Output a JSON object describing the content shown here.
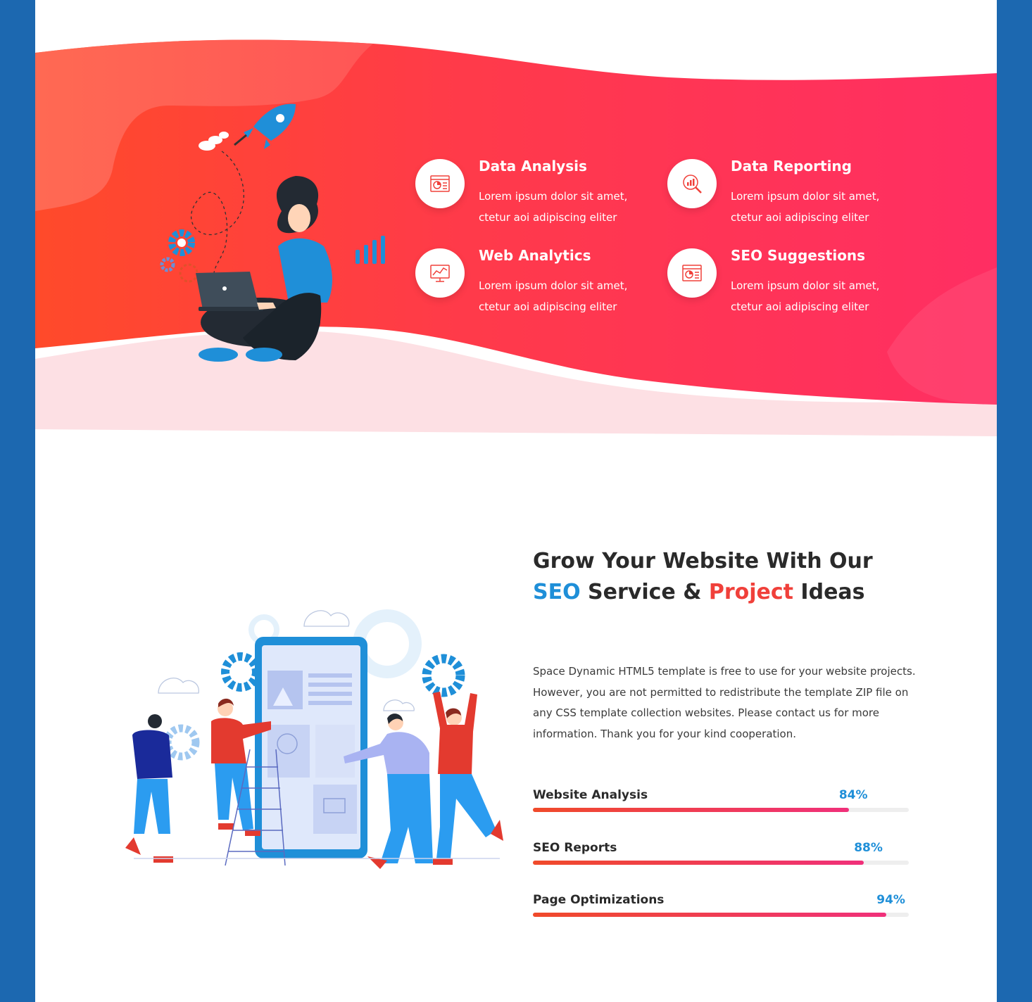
{
  "features": [
    {
      "id": "data-analysis",
      "title": "Data Analysis",
      "desc": "Lorem ipsum dolor sit amet, ctetur aoi adipiscing eliter",
      "icon": "chart-document-icon"
    },
    {
      "id": "data-reporting",
      "title": "Data Reporting",
      "desc": "Lorem ipsum dolor sit amet, ctetur aoi adipiscing eliter",
      "icon": "magnifier-chart-icon"
    },
    {
      "id": "web-analytics",
      "title": "Web Analytics",
      "desc": "Lorem ipsum dolor sit amet, ctetur aoi adipiscing eliter",
      "icon": "monitor-chart-icon"
    },
    {
      "id": "seo-suggestions",
      "title": "SEO Suggestions",
      "desc": "Lorem ipsum dolor sit amet, ctetur aoi adipiscing eliter",
      "icon": "chart-document-icon"
    }
  ],
  "about": {
    "heading_part1": "Grow Your Website With Our ",
    "heading_seo": "SEO",
    "heading_part2": " Service & ",
    "heading_project": "Project",
    "heading_part3": " Ideas",
    "paragraph": "Space Dynamic HTML5 template is free to use for your website projects. However, you are not permitted to redistribute the template ZIP file on any CSS template collection websites. Please contact us for more information. Thank you for your kind cooperation."
  },
  "skills": [
    {
      "label": "Website Analysis",
      "percent_text": "84%",
      "value": 0.84
    },
    {
      "label": "SEO Reports",
      "percent_text": "88%",
      "value": 0.88
    },
    {
      "label": "Page Optimizations",
      "percent_text": "94%",
      "value": 0.94
    }
  ],
  "colors": {
    "frame": "#1c68b0",
    "accent_red": "#f0403a",
    "accent_blue": "#1f8fd8",
    "wave_start": "#ff4a2a",
    "wave_end": "#ff2e63"
  }
}
